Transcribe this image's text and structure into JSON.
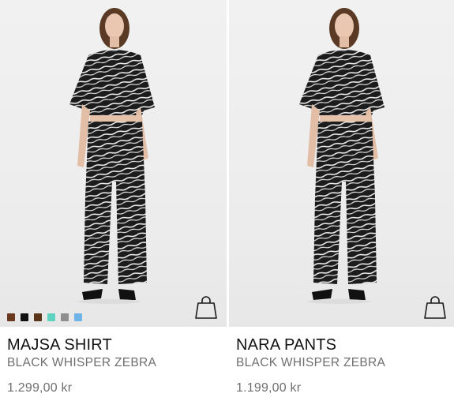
{
  "products": [
    {
      "name": "MAJSA SHIRT",
      "variant": "BLACK WHISPER ZEBRA",
      "price": "1.299,00 kr",
      "swatches": [
        "#6b3a1e",
        "#111111",
        "#5a3418",
        "#5fd3c0",
        "#8e8e8e",
        "#6fb4e6"
      ],
      "icon": "shopping-bag-icon"
    },
    {
      "name": "NARA PANTS",
      "variant": "BLACK WHISPER ZEBRA",
      "price": "1.199,00 kr",
      "swatches": [],
      "icon": "shopping-bag-icon"
    }
  ]
}
